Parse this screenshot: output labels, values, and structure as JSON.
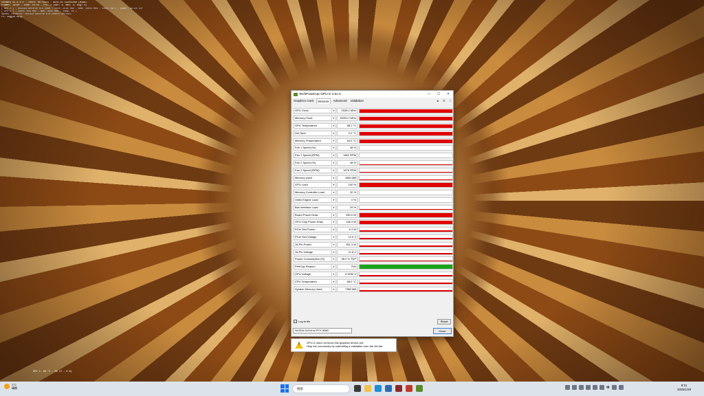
{
  "overlay_lines": [
    "FurMark v2.x.x.x - Tests: no-tests - Burn-in 1920x1080 (MSAA)",
    "Frames: 15xxx - time: xx:xx - FPS: x (min: x, max: x, avg: x)",
    "[ GPU 1 ] - NVIDIA GeForce RTX 5080 - core: 2535 MHz - mem: 15001 MHz - temp: 68 C - power: 98.9% TDP",
    "[ GPU 2 ] - core: xxx MHz - mem: xxxx MHz - temp: xx C",
    "OpenGL renderer: NVIDIA GeForce RTX 5080/PCIe/SSE2",
    "F1: toggle help"
  ],
  "mini_status": "GPU 1: 68 °C - 0% (0 - 0 W)",
  "window": {
    "title": "TechPowerUp GPU-Z 2.61.0",
    "controls": [
      "—",
      "☐",
      "✕"
    ],
    "tabs": [
      "Graphics Card",
      "Sensors",
      "Advanced",
      "Validation"
    ],
    "active_tab": "Sensors",
    "tab_icons": [
      "■",
      "⚙",
      "≡"
    ]
  },
  "sensors": [
    {
      "label": "GPU Clock",
      "value": "2535.0 MHz",
      "fill": 0.9
    },
    {
      "label": "Memory Clock",
      "value": "15001.0 MHz",
      "fill": 0.9
    },
    {
      "label": "GPU Temperature",
      "value": "68.1 °C",
      "fill": 0.75
    },
    {
      "label": "Hot Spot",
      "value": "0.0 °C",
      "fill": 0.75
    },
    {
      "label": "Memory Temperature",
      "value": "64.0 °C",
      "fill": 0.7
    },
    {
      "label": "Fan 1 Speed (%)",
      "value": "48 %",
      "fill": 0.1
    },
    {
      "label": "Fan 1 Speed (RPM)",
      "value": "1661 RPM",
      "fill": 0.1
    },
    {
      "label": "Fan 2 Speed (%)",
      "value": "48 %",
      "fill": 0.1
    },
    {
      "label": "Fan 2 Speed (RPM)",
      "value": "1676 RPM",
      "fill": 0.1
    },
    {
      "label": "Memory Used",
      "value": "1684 MB",
      "fill": 0.15
    },
    {
      "label": "GPU Load",
      "value": "100 %",
      "fill": 1.0
    },
    {
      "label": "Memory Controller Load",
      "value": "32 %",
      "fill": 0.05
    },
    {
      "label": "Video Engine Load",
      "value": "0 %",
      "fill": 0.0
    },
    {
      "label": "Bus Interface Load",
      "value": "29 %",
      "fill": 0.1
    },
    {
      "label": "Board Power Draw",
      "value": "350.0 W",
      "fill": 0.9
    },
    {
      "label": "GPU Chip Power Draw",
      "value": "136.3 W",
      "fill": 0.9
    },
    {
      "label": "PCIe Slot Power",
      "value": "6.3 W",
      "fill": 0.4
    },
    {
      "label": "PCIe Slot Voltage",
      "value": "12.0 V",
      "fill": 0.3
    },
    {
      "label": "16-Pin Power",
      "value": "351.3 W",
      "fill": 0.3
    },
    {
      "label": "16-Pin Voltage",
      "value": "11.8 V",
      "fill": 0.3
    },
    {
      "label": "Power Consumption (%)",
      "value": "98.9 % TDP",
      "fill": 0.3
    },
    {
      "label": "PerfCap Reason",
      "value": "Pwr",
      "fill": 1.0,
      "color": "#1aa31a"
    },
    {
      "label": "GPU Voltage",
      "value": "0.9250 V",
      "fill": 0.3
    },
    {
      "label": "CPU Temperature",
      "value": "68.0 °C",
      "fill": 0.3
    },
    {
      "label": "System Memory Used",
      "value": "7389 MB",
      "fill": 0.25
    }
  ],
  "log_label": "Log to file",
  "reset_label": "Reset",
  "gpu_select": "NVIDIA GeForce RTX 5080",
  "close_label": "Close",
  "notice": {
    "line1": "GPU-Z does not know this graphics device yet.",
    "line2": "Help the community by submitting a validation from the 4th tab."
  },
  "taskbar": {
    "weather_temp": "1°C",
    "weather_desc": "晴朗",
    "search_placeholder": "搜索",
    "time": "9:11",
    "date": "2025/1/29",
    "ime": "中"
  }
}
